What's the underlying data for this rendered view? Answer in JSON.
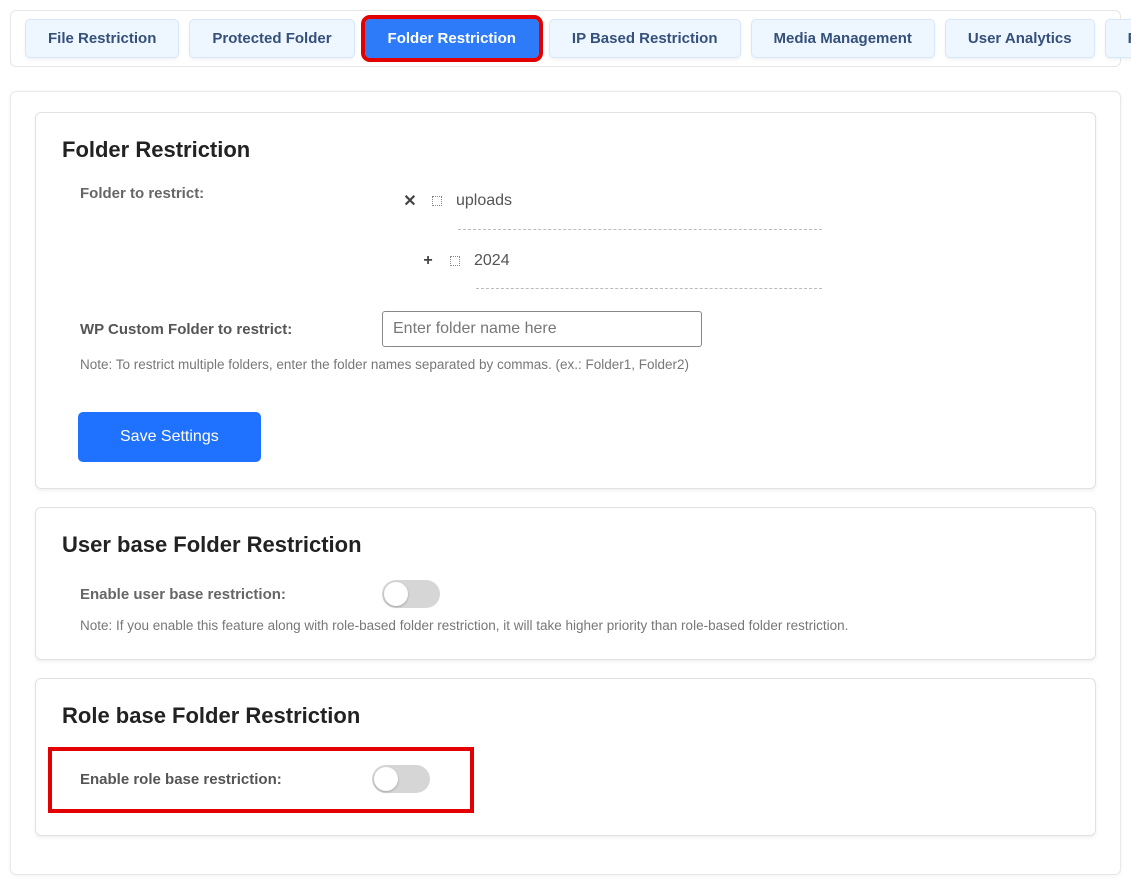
{
  "tabs": [
    {
      "label": "File Restriction"
    },
    {
      "label": "Protected Folder"
    },
    {
      "label": "Folder Restriction",
      "active": true
    },
    {
      "label": "IP Based Restriction"
    },
    {
      "label": "Media Management"
    },
    {
      "label": "User Analytics"
    },
    {
      "label": "File Analytics"
    }
  ],
  "folderRestriction": {
    "title": "Folder Restriction",
    "folderLabel": "Folder to restrict:",
    "tree": {
      "item0": "uploads",
      "item1": "2024"
    },
    "customLabel": "WP Custom Folder to restrict:",
    "customPlaceholder": "Enter folder name here",
    "note": "Note: To restrict multiple folders, enter the folder names separated by commas. (ex.: Folder1, Folder2)",
    "saveLabel": "Save Settings"
  },
  "userBase": {
    "title": "User base Folder Restriction",
    "label": "Enable user base restriction:",
    "note": "Note: If you enable this feature along with role-based folder restriction, it will take higher priority than role-based folder restriction."
  },
  "roleBase": {
    "title": "Role base Folder Restriction",
    "label": "Enable role base restriction:"
  }
}
